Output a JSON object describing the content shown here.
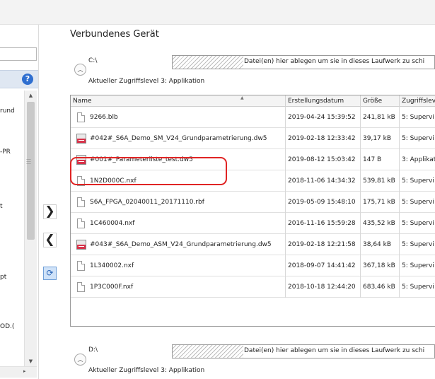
{
  "panel": {
    "title": "Verbundenes Gerät"
  },
  "left_tree": {
    "items": [
      "rund",
      "-PR",
      "t",
      "pt",
      "OD.("
    ]
  },
  "nav": {
    "forward_glyph": "❯",
    "back_glyph": "❮",
    "sync_icon": "sync-icon"
  },
  "drives": [
    {
      "label": "C:\\",
      "access_label": "Aktueller Zugriffslevel",
      "access_value": "3: Applikation",
      "drop_text": "Datei(en) hier ablegen um sie in dieses Laufwerk zu schi"
    },
    {
      "label": "D:\\",
      "access_label": "Aktueller Zugriffslevel",
      "access_value": "3: Applikation",
      "drop_text": "Datei(en) hier ablegen um sie in dieses Laufwerk zu schi"
    }
  ],
  "table": {
    "columns": [
      "Name",
      "Erstellungsdatum",
      "Größe",
      "Zugriffslev"
    ],
    "rows": [
      {
        "icon": "document-icon",
        "name": "9266.blb",
        "date": "2019-04-24 15:39:52",
        "size": "241,81 kB",
        "access": "5: Supervi"
      },
      {
        "icon": "kes-file-icon",
        "name": "#042#_S6A_Demo_SM_V24_Grundparametrierung.dw5",
        "date": "2019-02-18 12:33:42",
        "size": "39,17 kB",
        "access": "5: Supervi"
      },
      {
        "icon": "kes-file-icon",
        "name": "#001#_Parameterliste_test.dw5",
        "date": "2019-08-12 15:03:42",
        "size": "147 B",
        "access": "3: Applikat"
      },
      {
        "icon": "document-icon",
        "name": "1N2D000C.nxf",
        "date": "2018-11-06 14:34:32",
        "size": "539,81 kB",
        "access": "5: Supervi"
      },
      {
        "icon": "document-icon",
        "name": "S6A_FPGA_02040011_20171110.rbf",
        "date": "2019-05-09 15:48:10",
        "size": "175,71 kB",
        "access": "5: Supervi"
      },
      {
        "icon": "document-icon",
        "name": "1C460004.nxf",
        "date": "2016-11-16 15:59:28",
        "size": "435,52 kB",
        "access": "5: Supervi"
      },
      {
        "icon": "kes-file-icon",
        "name": "#043#_S6A_Demo_ASM_V24_Grundparametrierung.dw5",
        "date": "2019-02-18 12:21:58",
        "size": "38,64 kB",
        "access": "5: Supervi"
      },
      {
        "icon": "document-icon",
        "name": "1L340002.nxf",
        "date": "2018-09-07 14:41:42",
        "size": "367,18 kB",
        "access": "5: Supervi"
      },
      {
        "icon": "document-icon",
        "name": "1P3C000F.nxf",
        "date": "2018-10-18 12:44:20",
        "size": "683,46 kB",
        "access": "5: Supervi"
      }
    ]
  },
  "colors": {
    "highlight": "#e02424",
    "accent": "#2f6fd0",
    "kes_red": "#d8324a"
  }
}
